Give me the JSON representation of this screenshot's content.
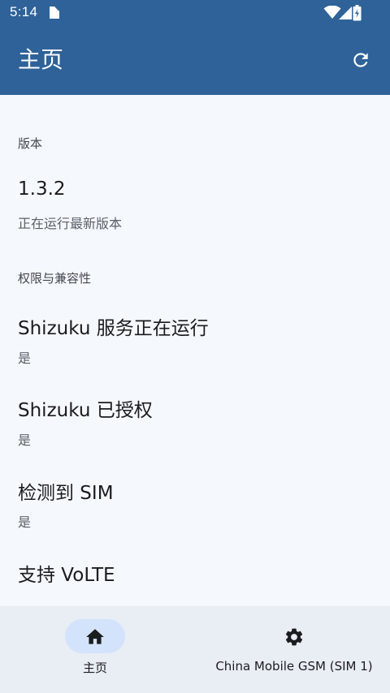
{
  "status_bar": {
    "time": "5:14",
    "icons": [
      "note-icon",
      "wifi-icon",
      "signal-icon",
      "battery-charging-icon"
    ]
  },
  "app_bar": {
    "title": "主页",
    "action_icon": "refresh-icon"
  },
  "sections": {
    "version": {
      "header": "版本",
      "title": "1.3.2",
      "subtitle": "正在运行最新版本"
    },
    "permissions": {
      "header": "权限与兼容性",
      "items": [
        {
          "title": "Shizuku 服务正在运行",
          "subtitle": "是"
        },
        {
          "title": "Shizuku 已授权",
          "subtitle": "是"
        },
        {
          "title": "检测到 SIM",
          "subtitle": "是"
        },
        {
          "title": "支持 VoLTE",
          "subtitle": ""
        }
      ]
    }
  },
  "bottom_nav": {
    "items": [
      {
        "label": "主页",
        "icon": "home-icon",
        "selected": true
      },
      {
        "label": "China Mobile GSM (SIM 1)",
        "icon": "gear-icon",
        "selected": false
      }
    ]
  },
  "colors": {
    "app_bar": "#2e6298",
    "background": "#f5f8fd",
    "bottom_nav": "#e9edf4",
    "nav_indicator": "#d3e3fb"
  }
}
